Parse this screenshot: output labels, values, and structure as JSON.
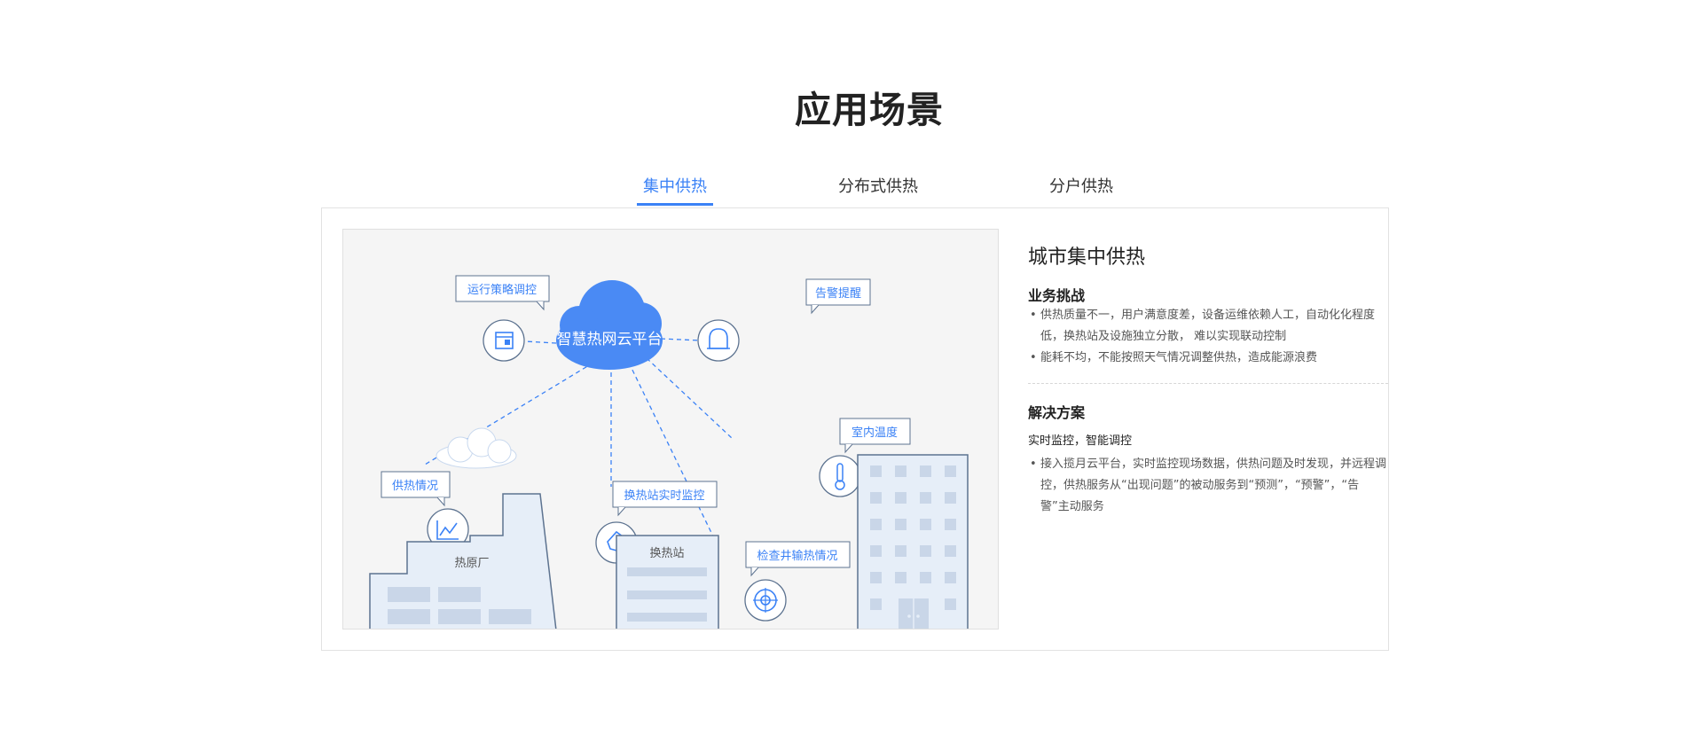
{
  "page_title": "应用场景",
  "tabs": [
    {
      "label": "集中供热",
      "active": true
    },
    {
      "label": "分布式供热",
      "active": false
    },
    {
      "label": "分户供热",
      "active": false
    }
  ],
  "illustration": {
    "cloud_label": "智慧热网云平台",
    "tags": {
      "strategy": "运行策略调控",
      "alarm": "告警提醒",
      "indoor_temp": "室内温度",
      "heating_status": "供热情况",
      "station_monitor": "换热站实时监控",
      "well_inspection": "检查井输热情况"
    },
    "buildings": {
      "plant": "热原厂",
      "station": "换热站"
    },
    "colors": {
      "accent": "#3b82f6",
      "cloud": "#4a8af4",
      "building_fill": "#e6eef8",
      "building_stroke": "#5d7390",
      "window": "#c9d6e8"
    }
  },
  "side": {
    "heading": "城市集中供热",
    "challenge_title": "业务挑战",
    "challenges": [
      "供热质量不一，用户满意度差，设备运维依赖人工，自动化化程度低，换热站及设施独立分散， 难以实现联动控制",
      "能耗不均，不能按照天气情况调整供热，造成能源浪费"
    ],
    "solution_title": "解决方案",
    "solution_subtitle": "实时监控，智能调控",
    "solutions": [
      "接入揽月云平台，实时监控现场数据，供热问题及时发现，并远程调控，供热服务从“出现问题”的被动服务到“预测”，“预警”，“告警”主动服务"
    ]
  }
}
